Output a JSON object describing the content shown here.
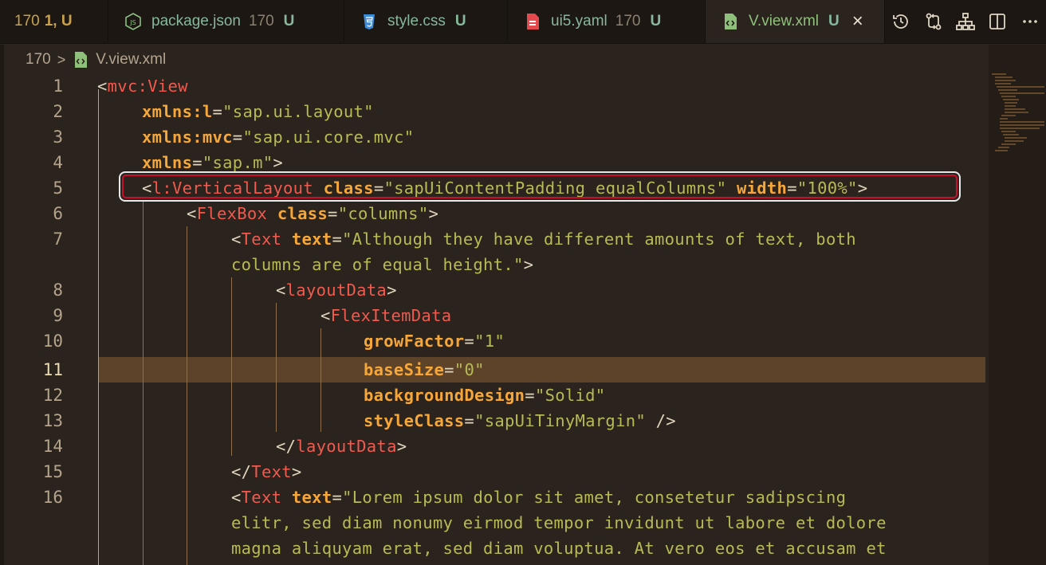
{
  "tabs": [
    {
      "count": "170",
      "badge": "1, U",
      "partial": true
    },
    {
      "name": "package.json",
      "count": "170",
      "badge": "U",
      "icon": "nodejs-icon"
    },
    {
      "name": "style.css",
      "count": "",
      "badge": "U",
      "icon": "css-icon"
    },
    {
      "name": "ui5.yaml",
      "count": "170",
      "badge": "U",
      "icon": "yaml-icon"
    },
    {
      "name": "V.view.xml",
      "count": "",
      "badge": "U",
      "icon": "xml-icon",
      "active": true,
      "close": "×"
    }
  ],
  "actions": [
    "history-icon",
    "source-compare-icon",
    "hierarchy-icon",
    "split-editor-icon",
    "more-icon"
  ],
  "breadcrumb": {
    "folder": "170",
    "separator": ">",
    "file": "V.view.xml"
  },
  "editor": {
    "current_line": 11,
    "line_numbers": [
      "1",
      "2",
      "3",
      "4",
      "5",
      "6",
      "7",
      "",
      "8",
      "9",
      "10",
      "11",
      "12",
      "13",
      "14",
      "15",
      "16",
      "",
      "",
      ""
    ]
  },
  "colors": {
    "tag": "#f05a4f",
    "attribute": "#f6a73a",
    "string": "#b8bb55",
    "current_line": "#5e432b",
    "focus_outline": "#c8102e"
  }
}
